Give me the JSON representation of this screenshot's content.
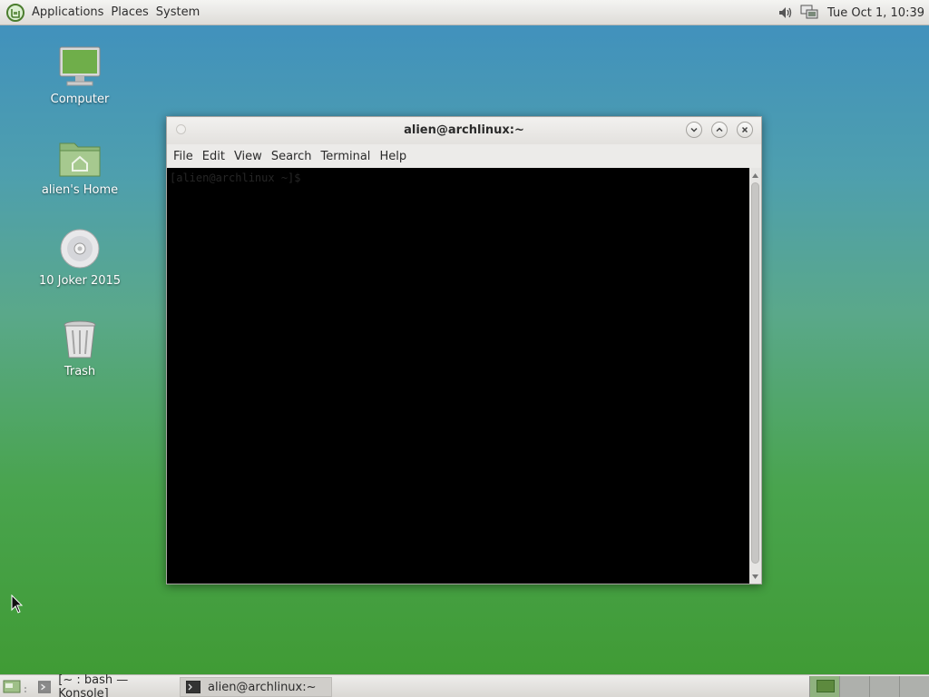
{
  "top_panel": {
    "menus": [
      "Applications",
      "Places",
      "System"
    ],
    "clock": "Tue Oct  1, 10:39"
  },
  "desktop": {
    "icons": [
      {
        "label": "Computer",
        "icon": "computer-icon"
      },
      {
        "label": "alien's Home",
        "icon": "home-folder-icon"
      },
      {
        "label": "10 Joker 2015",
        "icon": "disc-icon"
      },
      {
        "label": "Trash",
        "icon": "trash-icon"
      }
    ]
  },
  "window": {
    "title": "alien@archlinux:~",
    "menus": [
      "File",
      "Edit",
      "View",
      "Search",
      "Terminal",
      "Help"
    ],
    "prompt": "[alien@archlinux ~]$",
    "colors": {
      "terminal_bg": "#000000",
      "prompt_fg": "#262626"
    }
  },
  "bottom_panel": {
    "tasks": [
      "[~ : bash — Konsole]",
      "alien@archlinux:~"
    ],
    "workspaces": 4
  },
  "colors": {
    "panel": "#e4e2de",
    "desktop_top": "#3f8fbf",
    "desktop_bottom": "#3f9a32"
  }
}
